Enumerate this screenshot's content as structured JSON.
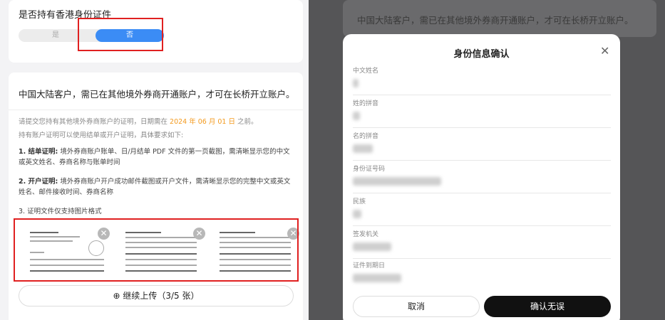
{
  "left": {
    "question": "是否持有香港身份证件",
    "option_yes": "是",
    "option_no": "否",
    "notice": "中国大陆客户，需已在其他境外券商开通账户，才可在长桥开立账户。",
    "desc_prefix": "请提交您持有其他境外券商账户的证明，日期需在",
    "desc_date": "2024 年 06 月 01 日",
    "desc_suffix": "之前。",
    "desc2": "持有账户证明可以使用结单或开户证明，具体要求如下:",
    "item1_title": "1. 结单证明:",
    "item1_text": "境外券商账户账单、日/月结单 PDF 文件的第一页截图，需清晰显示您的中文或英文姓名、券商名称与账单时间",
    "item2_title": "2. 开户证明:",
    "item2_text": "境外券商账户开户成功邮件截图或开户文件，需清晰显示您的完整中文或英文姓名、邮件接收时间、券商名称",
    "item3": "3. 证明文件仅支持图片格式",
    "remove_symbol": "✕",
    "upload_icon": "⊕",
    "upload_label": "继续上传（3/5 张）"
  },
  "right": {
    "bg_notice": "中国大陆客户，需已在其他境外券商开通账户，才可在长桥开立账户。",
    "modal_title": "身份信息确认",
    "close_symbol": "✕",
    "fields": [
      {
        "label": "中文姓名"
      },
      {
        "label": "姓的拼音"
      },
      {
        "label": "名的拼音"
      },
      {
        "label": "身份证号码"
      },
      {
        "label": "民族"
      },
      {
        "label": "签发机关"
      },
      {
        "label": "证件到期日"
      }
    ],
    "cancel": "取消",
    "confirm": "确认无误"
  },
  "colors": {
    "accent": "#3b8cf5",
    "highlight": "#e02020",
    "date": "#f39a1e",
    "confirm_bg": "#111111"
  }
}
